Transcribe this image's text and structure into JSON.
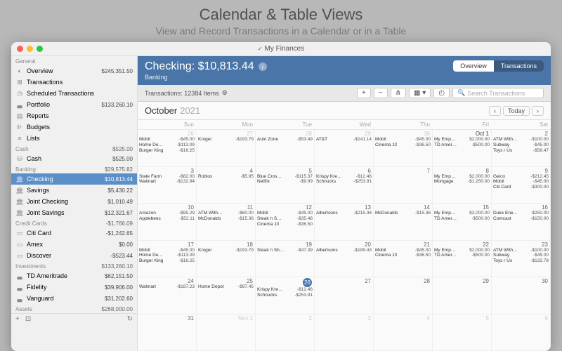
{
  "headline": "Calendar & Table Views",
  "subheadline": "View and Record Transactions in a Calendar or in a Table",
  "window_title": "My Finances",
  "sidebar": {
    "groups": [
      {
        "label": "General",
        "amount": "",
        "items": [
          {
            "icon": "◐",
            "label": "Overview",
            "amount": "$245,351.50"
          },
          {
            "icon": "⊞",
            "label": "Transactions",
            "amount": ""
          },
          {
            "icon": "◷",
            "label": "Scheduled Transactions",
            "amount": ""
          },
          {
            "icon": "▃",
            "label": "Portfolio",
            "amount": "$133,260.10"
          },
          {
            "icon": "▤",
            "label": "Reports",
            "amount": ""
          },
          {
            "icon": "⊪",
            "label": "Budgets",
            "amount": ""
          },
          {
            "icon": "≡",
            "label": "Lists",
            "amount": ""
          }
        ]
      },
      {
        "label": "Cash",
        "amount": "$525.00",
        "items": [
          {
            "icon": "⛁",
            "label": "Cash",
            "amount": "$525.00"
          }
        ]
      },
      {
        "label": "Banking",
        "amount": "$29,575.82",
        "items": [
          {
            "icon": "🏛",
            "label": "Checking",
            "amount": "$10,813.44",
            "selected": true
          },
          {
            "icon": "🏛",
            "label": "Savings",
            "amount": "$5,430.22"
          },
          {
            "icon": "🏛",
            "label": "Joint Checking",
            "amount": "$1,010.49"
          },
          {
            "icon": "🏛",
            "label": "Joint Savings",
            "amount": "$12,321.67"
          }
        ]
      },
      {
        "label": "Credit Cards",
        "amount": "-$1,766.09",
        "items": [
          {
            "icon": "▭",
            "label": "Citi Card",
            "amount": "-$1,242.65"
          },
          {
            "icon": "▭",
            "label": "Amex",
            "amount": "$0.00"
          },
          {
            "icon": "▭",
            "label": "Discover",
            "amount": "-$523.44"
          }
        ]
      },
      {
        "label": "Investments",
        "amount": "$133,260.10",
        "items": [
          {
            "icon": "▃",
            "label": "TD Ameritrade",
            "amount": "$62,151.50"
          },
          {
            "icon": "▃",
            "label": "Fidelity",
            "amount": "$39,906.00"
          },
          {
            "icon": "▃",
            "label": "Vanguard",
            "amount": "$31,202.60"
          }
        ]
      },
      {
        "label": "Assets",
        "amount": "$268,000.00",
        "items": []
      }
    ]
  },
  "header": {
    "title": "Checking: $10,813.44",
    "subtitle": "Banking"
  },
  "segmented": {
    "left": "Overview",
    "right": "Transactions"
  },
  "toolbar": {
    "count": "Transactions: 12384 Items",
    "search_placeholder": "Search Transactions"
  },
  "calendar": {
    "month": "October",
    "year": "2021",
    "today": "Today",
    "dow": [
      "Sun",
      "Mon",
      "Tue",
      "Wed",
      "Thu",
      "Fri",
      "Sat"
    ],
    "cells": [
      {
        "d": "26",
        "dim": true,
        "tx": [
          [
            "Mobil",
            "-$45.00"
          ],
          [
            "Home De…",
            "-$113.09"
          ],
          [
            "Burger King",
            "-$16.25"
          ]
        ]
      },
      {
        "d": "27",
        "dim": true,
        "tx": [
          [
            "Kroger",
            "-$193.79"
          ]
        ]
      },
      {
        "d": "28",
        "dim": true,
        "tx": [
          [
            "Auto Zone",
            "-$53.49"
          ]
        ]
      },
      {
        "d": "29",
        "dim": true,
        "tx": [
          [
            "AT&T",
            "-$141.14"
          ]
        ]
      },
      {
        "d": "30",
        "dim": true,
        "tx": [
          [
            "Mobil",
            "-$45.00"
          ],
          [
            "Cinema 10",
            "-$36.50"
          ]
        ]
      },
      {
        "d": "Oct 1",
        "fd": true,
        "tx": [
          [
            "My Emp…",
            "$2,000.00"
          ],
          [
            "TD Amer…",
            "-$500.00"
          ]
        ]
      },
      {
        "d": "2",
        "tx": [
          [
            "ATM With…",
            "-$100.00"
          ],
          [
            "Subway",
            "-$45.00"
          ],
          [
            "Toys r Us",
            "-$56.47"
          ]
        ]
      },
      {
        "d": "3",
        "tx": [
          [
            "State Farm",
            "-$82.00"
          ],
          [
            "Walmart",
            "-$132.84"
          ]
        ]
      },
      {
        "d": "4",
        "tx": [
          [
            "Roblox",
            "-$5.95"
          ]
        ]
      },
      {
        "d": "5",
        "tx": [
          [
            "Blue Cros…",
            "-$115.37"
          ],
          [
            "Netflix",
            "-$9.99"
          ]
        ]
      },
      {
        "d": "6",
        "tx": [
          [
            "Krispy Kre…",
            "-$12.46"
          ],
          [
            "Schnucks",
            "-$253.91"
          ]
        ]
      },
      {
        "d": "7",
        "tx": []
      },
      {
        "d": "8",
        "tx": [
          [
            "My Emp…",
            "$2,000.00"
          ],
          [
            "Mortgage",
            "-$1,250.00"
          ]
        ]
      },
      {
        "d": "9",
        "tx": [
          [
            "Geico",
            "-$212.45"
          ],
          [
            "Mobil",
            "-$45.00"
          ],
          [
            "Citi Card",
            "-$300.00"
          ]
        ]
      },
      {
        "d": "10",
        "tx": [
          [
            "Amazon",
            "-$95.29"
          ],
          [
            "Applebees",
            "-$52.11"
          ]
        ]
      },
      {
        "d": "11",
        "tx": [
          [
            "ATM With…",
            "-$60.00"
          ],
          [
            "McDonalds",
            "-$15.36"
          ]
        ]
      },
      {
        "d": "12",
        "tx": [
          [
            "Mobil",
            "-$45.00"
          ],
          [
            "Steak n S…",
            "-$35.48"
          ],
          [
            "Cinema 10",
            "-$36.50"
          ]
        ]
      },
      {
        "d": "13",
        "tx": [
          [
            "Albertsons",
            "-$215.36"
          ]
        ]
      },
      {
        "d": "14",
        "tx": [
          [
            "McDonalds",
            "-$15.36"
          ]
        ]
      },
      {
        "d": "15",
        "tx": [
          [
            "My Emp…",
            "$2,000.00"
          ],
          [
            "TD Amer…",
            "-$500.00"
          ]
        ]
      },
      {
        "d": "16",
        "tx": [
          [
            "Duke Ene…",
            "-$250.00"
          ],
          [
            "Comcast",
            "-$150.00"
          ]
        ]
      },
      {
        "d": "17",
        "tx": [
          [
            "Mobil",
            "-$45.00"
          ],
          [
            "Home De…",
            "-$113.09"
          ],
          [
            "Burger King",
            "-$16.25"
          ]
        ]
      },
      {
        "d": "18",
        "tx": [
          [
            "Kroger",
            "-$193.79"
          ]
        ]
      },
      {
        "d": "19",
        "tx": [
          [
            "Steak n Sh…",
            "-$47.39"
          ]
        ]
      },
      {
        "d": "20",
        "tx": [
          [
            "Albertsons",
            "-$189.43"
          ]
        ]
      },
      {
        "d": "21",
        "tx": [
          [
            "Mobil",
            "-$45.00"
          ],
          [
            "Cinema 10",
            "-$36.50"
          ]
        ]
      },
      {
        "d": "22",
        "tx": [
          [
            "My Emp…",
            "$2,000.00"
          ],
          [
            "TD Amer…",
            "-$500.00"
          ]
        ]
      },
      {
        "d": "23",
        "tx": [
          [
            "ATM With…",
            "-$100.00"
          ],
          [
            "Subway",
            "-$45.00"
          ],
          [
            "Toys r Us",
            "-$132.78"
          ]
        ]
      },
      {
        "d": "24",
        "tx": [
          [
            "Walmart",
            "-$187.23"
          ]
        ]
      },
      {
        "d": "25",
        "tx": [
          [
            "Home Depot",
            "-$97.45"
          ]
        ]
      },
      {
        "d": "26",
        "today": true,
        "tx": [
          [
            "Krispy Kre…",
            "-$12.46"
          ],
          [
            "Schnucks",
            "-$253.91"
          ]
        ]
      },
      {
        "d": "27",
        "tx": []
      },
      {
        "d": "28",
        "tx": []
      },
      {
        "d": "29",
        "tx": []
      },
      {
        "d": "30",
        "tx": []
      },
      {
        "d": "31",
        "tx": []
      },
      {
        "d": "Nov 1",
        "dim": true,
        "tx": []
      },
      {
        "d": "2",
        "dim": true,
        "tx": []
      },
      {
        "d": "3",
        "dim": true,
        "tx": []
      },
      {
        "d": "4",
        "dim": true,
        "tx": []
      },
      {
        "d": "5",
        "dim": true,
        "tx": []
      },
      {
        "d": "6",
        "dim": true,
        "tx": []
      }
    ]
  }
}
